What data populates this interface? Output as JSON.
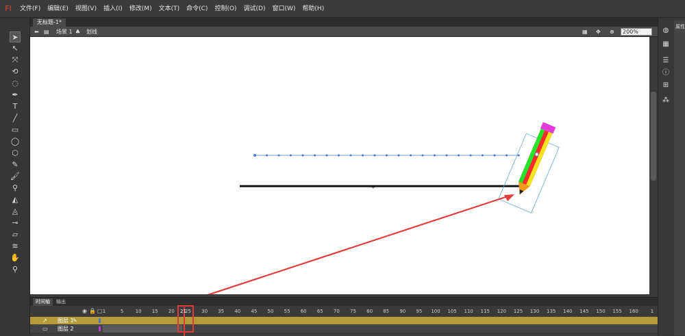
{
  "app": {
    "logo": "Fl"
  },
  "menu": [
    "文件(F)",
    "编辑(E)",
    "视图(V)",
    "插入(I)",
    "修改(M)",
    "文本(T)",
    "命令(C)",
    "控制(O)",
    "调试(D)",
    "窗口(W)",
    "帮助(H)"
  ],
  "document": {
    "tab_title": "无标题-1*",
    "scene_label": "场景 1",
    "symbol_label": "划线",
    "zoom": "200%"
  },
  "tools": [
    "selection-icon",
    "subselection-icon",
    "free-transform-icon",
    "3d-rotation-icon",
    "lasso-icon",
    "pen-icon",
    "text-icon",
    "line-icon",
    "rectangle-icon",
    "oval-icon",
    "polystar-icon",
    "pencil-icon",
    "brush-icon",
    "bone-icon",
    "paint-bucket-icon",
    "ink-bottle-icon",
    "eyedropper-icon",
    "eraser-icon",
    "width-icon",
    "hand-icon",
    "zoom-icon"
  ],
  "timeline": {
    "tabs": [
      "时间轴",
      "输出"
    ],
    "frame_numbers": [
      "1",
      "5",
      "10",
      "15",
      "20",
      "25",
      "30",
      "35",
      "40",
      "45",
      "50",
      "55",
      "60",
      "65",
      "70",
      "75",
      "80",
      "85",
      "90",
      "95",
      "100",
      "105",
      "110",
      "115",
      "120",
      "125",
      "130",
      "135",
      "140",
      "145",
      "150",
      "155",
      "160",
      "1"
    ],
    "current_frame": "21",
    "layers": [
      {
        "name": "图层 1",
        "selected": true
      },
      {
        "name": "图层 2",
        "selected": false
      }
    ]
  },
  "side_panel": {
    "label": "属性"
  },
  "colors": {
    "accent": "#e23b3b",
    "layer_highlight": "#b59a3a",
    "stage": "#ffffff"
  }
}
